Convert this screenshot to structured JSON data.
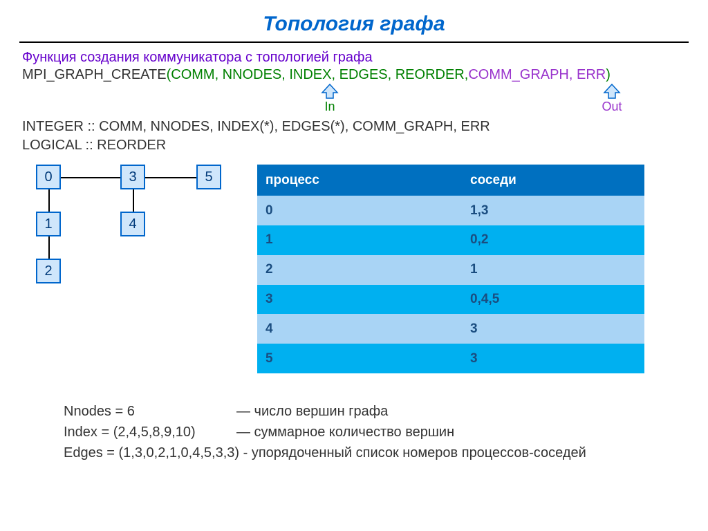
{
  "title": "Топология графа",
  "desc": "Функция  создания коммуникатора с топологией графа",
  "func": {
    "name": "MPI_GRAPH_CREATE",
    "args_in": "COMM,  NNODES, INDEX, EDGES, REORDER,",
    "args_out": "COMM_GRAPH, ERR"
  },
  "arrows": {
    "in": "In",
    "out": "Out"
  },
  "decl1": "INTEGER :: COMM, NNODES, INDEX(*), EDGES(*), COMM_GRAPH, ERR",
  "decl2": "LOGICAL :: REORDER",
  "graph_nodes": [
    "0",
    "1",
    "2",
    "3",
    "4",
    "5"
  ],
  "table": {
    "h1": "процесс",
    "h2": "соседи",
    "rows": [
      {
        "p": "0",
        "n": "1,3"
      },
      {
        "p": "1",
        "n": "0,2"
      },
      {
        "p": "2",
        "n": "1"
      },
      {
        "p": "3",
        "n": "0,4,5"
      },
      {
        "p": "4",
        "n": "3"
      },
      {
        "p": "5",
        "n": "3"
      }
    ]
  },
  "bottom": {
    "nnodes_l": "Nnodes = 6",
    "nnodes_d": "—   число вершин графа",
    "index_l": "Index = (2,4,5,8,9,10)",
    "index_d": "—  суммарное количество вершин",
    "edges": "Edges = (1,3,0,2,1,0,4,5,3,3)  - упорядоченный  список номеров процессов-соседей"
  }
}
